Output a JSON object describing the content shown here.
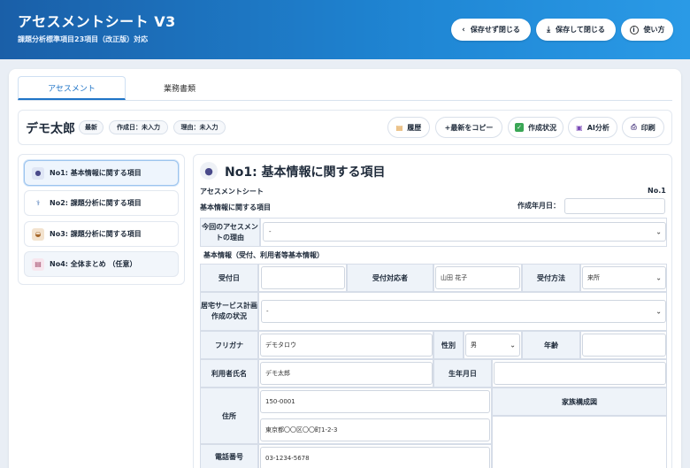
{
  "header": {
    "title": "アセスメントシート V3",
    "subtitle": "課題分析標準項目23項目（改正版）対応",
    "buttons": {
      "close_no_save": "保存せず閉じる",
      "save_close": "保存して閉じる",
      "help": "使い方"
    }
  },
  "tabs": [
    {
      "label": "アセスメント",
      "active": true
    },
    {
      "label": "業務書類",
      "active": false
    }
  ],
  "subbar": {
    "person_name": "デモ太郎",
    "chips": [
      "最新",
      "作成日：未入力",
      "理由：未入力"
    ],
    "actions": {
      "history": "履歴",
      "copy_latest": "+最新をコピー",
      "status": "作成状況",
      "ai": "AI分析",
      "print": "印刷"
    }
  },
  "sidebar": {
    "items": [
      {
        "label": "No1: 基本情報に関する項目",
        "icon": "person-icon"
      },
      {
        "label": "No2: 課題分析に関する項目",
        "icon": "stethoscope-icon"
      },
      {
        "label": "No3: 課題分析に関する項目",
        "icon": "basket-icon"
      },
      {
        "label": "No4: 全体まとめ （任意）",
        "icon": "memo-icon"
      }
    ]
  },
  "section": {
    "title": "No1: 基本情報に関する項目",
    "sheet_label": "アセスメントシート",
    "sheet_no": "No.1",
    "sub_label": "基本情報に関する項目",
    "created_label": "作成年月日：",
    "created_value": "",
    "reason_label": "今回のアセスメントの理由",
    "reason_value": "-",
    "basic_heading": "基本情報（受付、利用者等基本情報）",
    "table": {
      "reception_date_label": "受付日",
      "reception_date_value": "",
      "reception_staff_label": "受付対応者",
      "reception_staff_value": "山田 花子",
      "reception_method_label": "受付方法",
      "reception_method_value": "来所",
      "plan_label_1": "居宅サービス計画",
      "plan_label_2": "作成の状況",
      "plan_value": "-",
      "furigana_label": "フリガナ",
      "furigana_value": "デモタロウ",
      "gender_label": "性別",
      "gender_value": "男",
      "age_label": "年齢",
      "age_value": "",
      "name_label": "利用者氏名",
      "name_value": "デモ太郎",
      "birth_label": "生年月日",
      "birth_value": "",
      "address_label": "住所",
      "postal_value": "150-0001",
      "address_value": "東京都〇〇区〇〇町1-2-3",
      "family_label": "家族構成図",
      "phone_label": "電話番号",
      "phone_value": "03-1234-5678"
    }
  },
  "colors": {
    "header_start": "#1a5fa8",
    "header_end": "#2a9ae6",
    "accent": "#1f74c7"
  }
}
